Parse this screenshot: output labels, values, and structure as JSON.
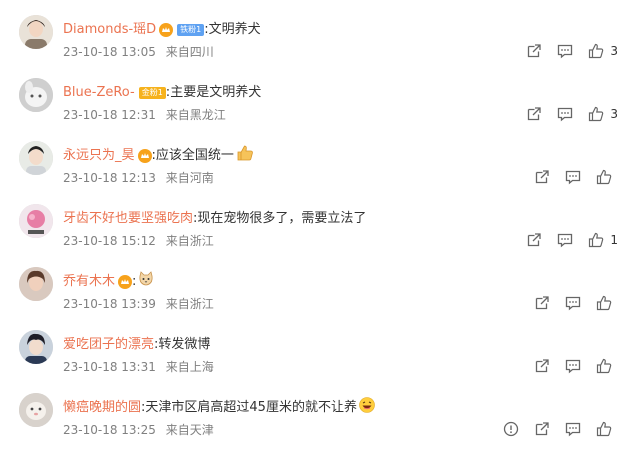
{
  "comments": [
    {
      "user": "Diamonds-瑶D",
      "badge": "铁粉1",
      "text": "文明养犬",
      "time": "23-10-18 13:05",
      "location": "来自四川",
      "likes": "3"
    },
    {
      "user": "Blue-ZeRo-",
      "badge": "金粉1",
      "text": "主要是文明养犬",
      "time": "23-10-18 12:31",
      "location": "来自黑龙江",
      "likes": "3"
    },
    {
      "user": "永远只为_昊",
      "text": "应该全国统一",
      "time": "23-10-18 12:13",
      "location": "来自河南",
      "likes": ""
    },
    {
      "user": "牙齿不好也要坚强吃肉",
      "text": "现在宠物很多了，需要立法了",
      "time": "23-10-18 15:12",
      "location": "来自浙江",
      "likes": "1"
    },
    {
      "user": "乔有木木",
      "text": "",
      "time": "23-10-18 13:39",
      "location": "来自浙江",
      "likes": ""
    },
    {
      "user": "爱吃团子的漂亮",
      "text": "转发微博",
      "time": "23-10-18 13:31",
      "location": "来自上海",
      "likes": ""
    },
    {
      "user": "懒癌晚期的圆",
      "text": "天津市区肩高超过45厘米的就不让养",
      "time": "23-10-18 13:25",
      "location": "来自天津",
      "likes": ""
    }
  ],
  "separator": ":",
  "icons": {
    "share": "share-icon",
    "comment": "comment-icon",
    "like": "thumbs-up-icon",
    "report": "report-icon",
    "crown": "crown-icon"
  },
  "colors": {
    "username": "#eb7350",
    "meta": "#808080",
    "badge_blue": "#5fa2f2",
    "badge_gold": "#f6b21d"
  }
}
